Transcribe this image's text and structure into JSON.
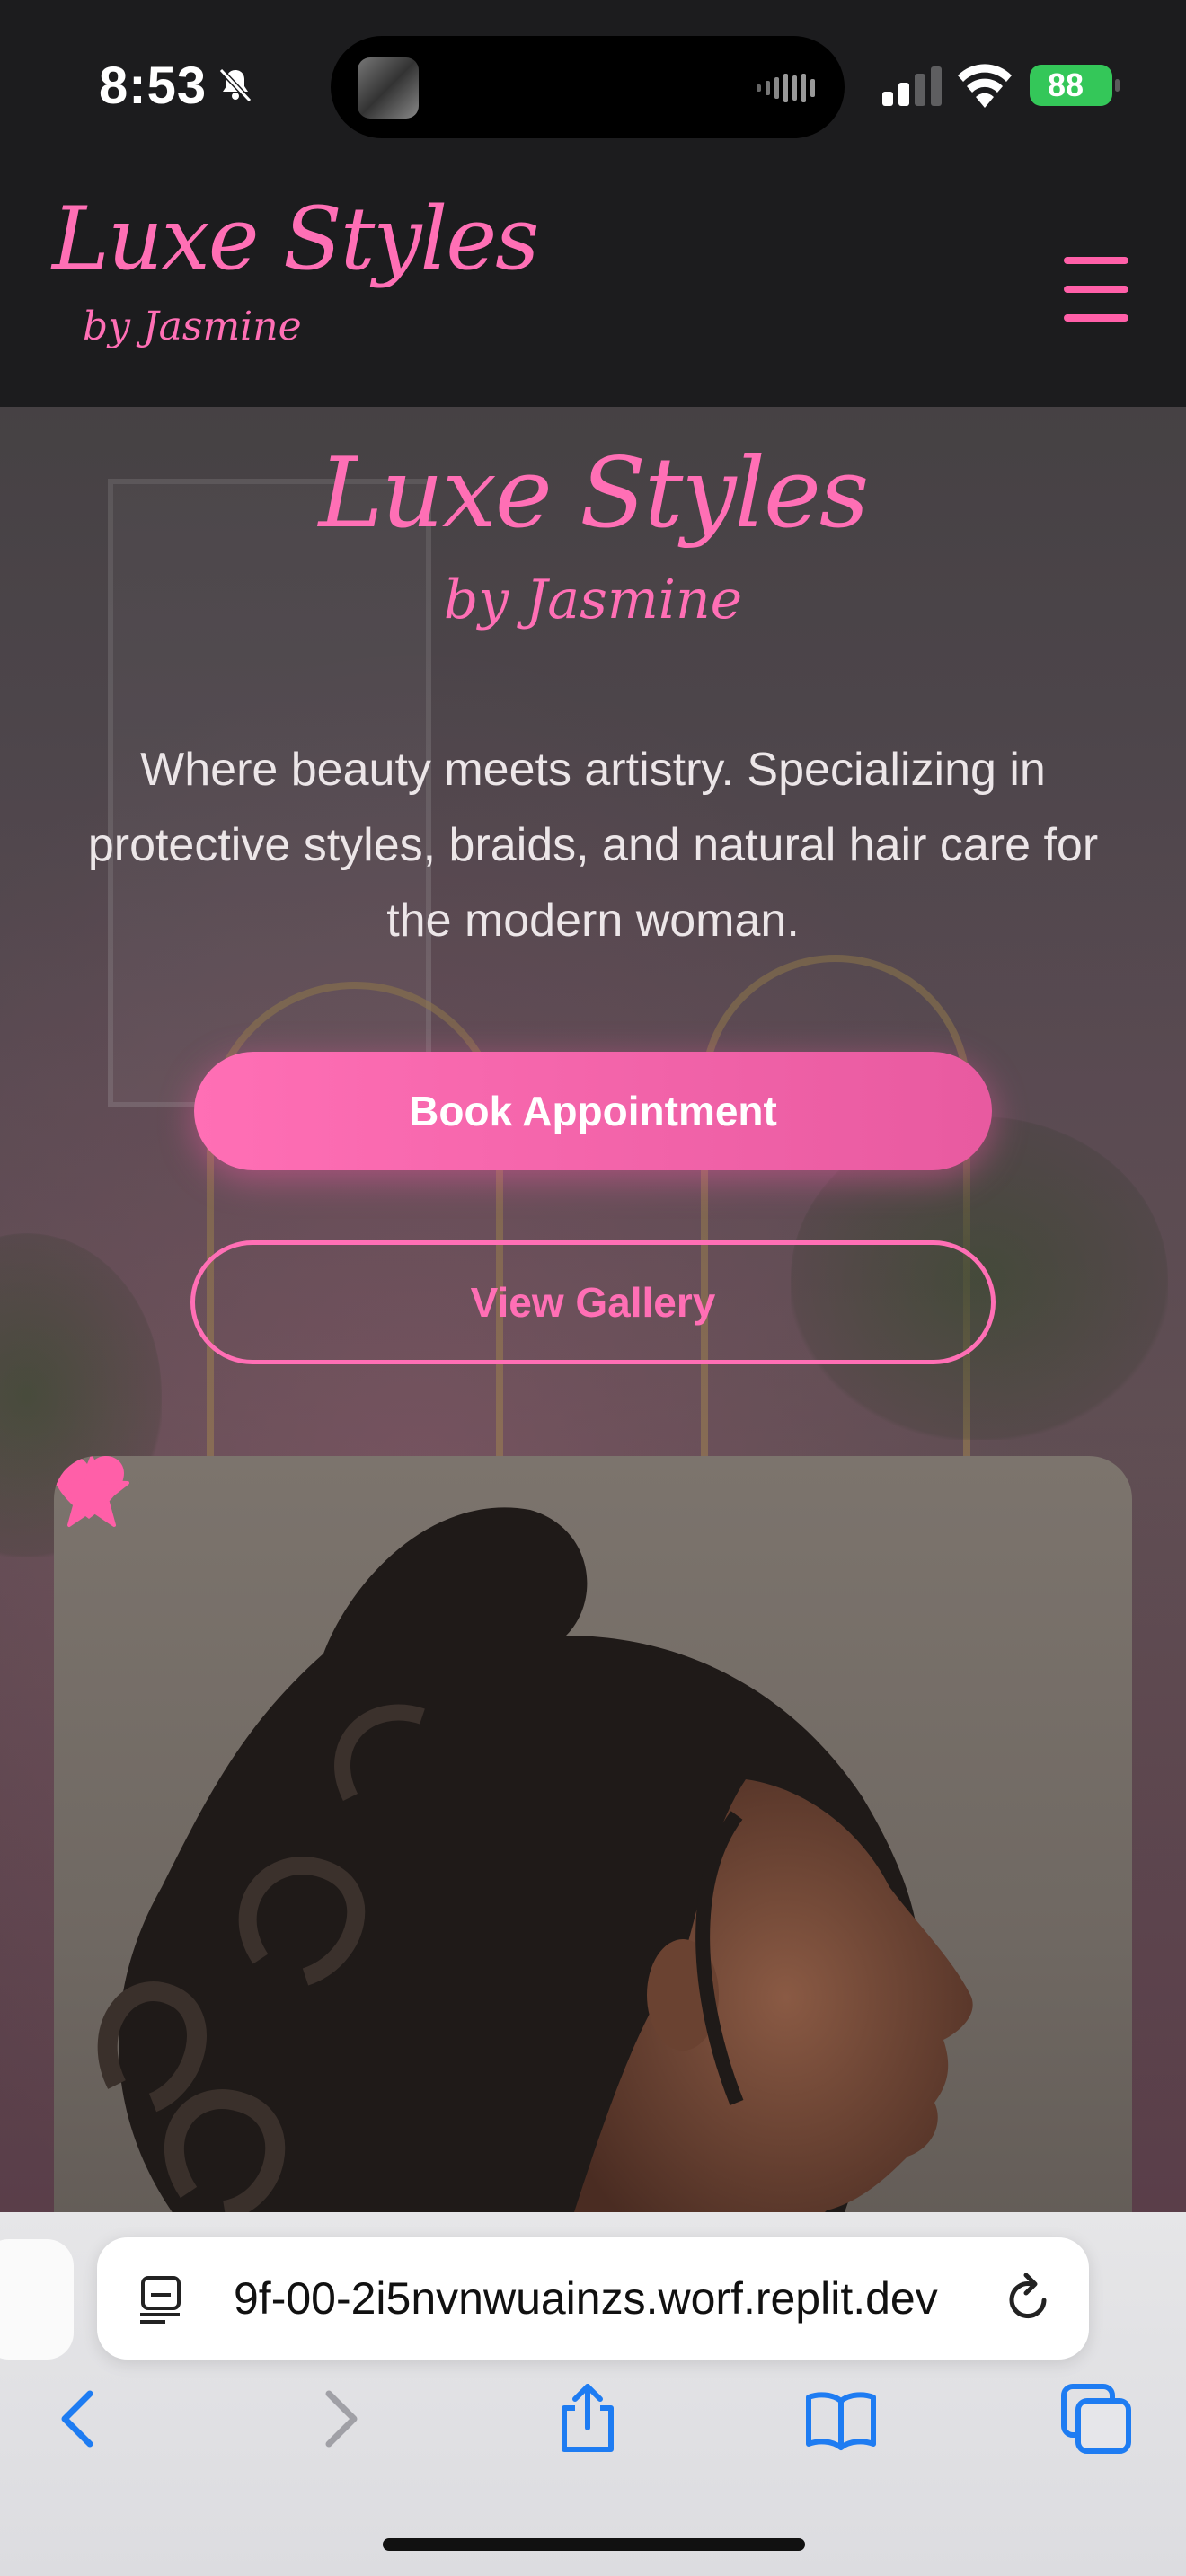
{
  "status_bar": {
    "time": "8:53",
    "battery": "88",
    "icons": [
      "bell-slash-icon",
      "waveform-icon",
      "cellular-signal-icon",
      "wifi-icon",
      "battery-charging-icon"
    ]
  },
  "header": {
    "logo_main": "Luxe Styles",
    "logo_sub": "by Jasmine",
    "menu_icon": "hamburger-menu-icon"
  },
  "hero": {
    "title": "Luxe Styles",
    "subtitle": "by Jasmine",
    "tagline": "Where beauty meets artistry. Specializing in protective styles, braids, and natural hair care for the modern woman.",
    "primary_button": "Book Appointment",
    "secondary_button": "View Gallery",
    "decor_icons": [
      "heart-icon",
      "star-icon"
    ]
  },
  "browser": {
    "url": "9f-00-2i5nvnwuainzs.worf.replit.dev",
    "toolbar": [
      "back-icon",
      "forward-icon",
      "share-icon",
      "bookmarks-icon",
      "tabs-icon"
    ]
  },
  "colors": {
    "accent": "#ff6fb5",
    "header_bg": "#1c1c1e",
    "battery": "#34c759",
    "ios_blue": "#1e7cf2"
  }
}
